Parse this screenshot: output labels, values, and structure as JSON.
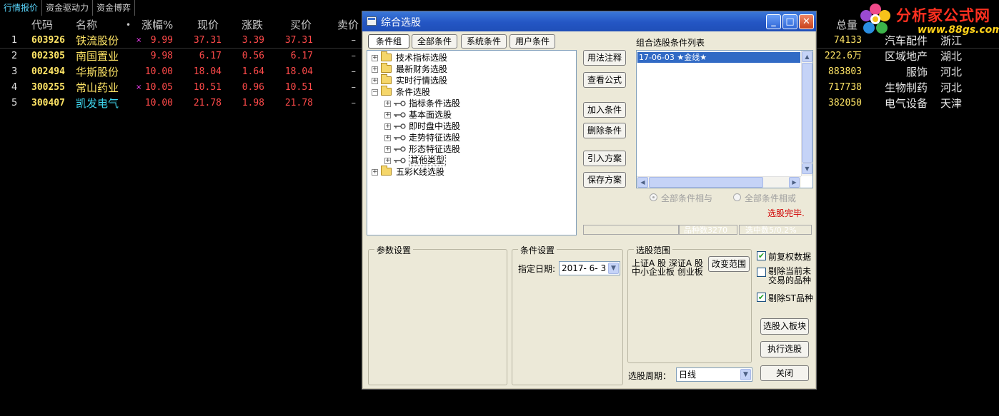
{
  "tabs": [
    "行情报价",
    "资金驱动力",
    "资金博弈"
  ],
  "table": {
    "headers": {
      "code": "代码",
      "name": "名称",
      "dot": "•",
      "pct": "涨幅%",
      "price": "现价",
      "change": "涨跌",
      "bid": "买价",
      "ask": "卖价",
      "volume": "总量"
    },
    "rows": [
      {
        "idx": "1",
        "code": "603926",
        "name": "铁流股份",
        "mark": "×",
        "pct": "9.99",
        "price": "37.31",
        "change": "3.39",
        "bid": "37.31",
        "ask": "–",
        "volume": "74133",
        "industry": "汽车配件",
        "region": "浙江"
      },
      {
        "idx": "2",
        "code": "002305",
        "name": "南国置业",
        "mark": "",
        "pct": "9.98",
        "price": "6.17",
        "change": "0.56",
        "bid": "6.17",
        "ask": "–",
        "volume": "222.6万",
        "industry": "区域地产",
        "region": "湖北"
      },
      {
        "idx": "3",
        "code": "002494",
        "name": "华斯股份",
        "mark": "",
        "pct": "10.00",
        "price": "18.04",
        "change": "1.64",
        "bid": "18.04",
        "ask": "–",
        "volume": "883803",
        "industry": "服饰",
        "region": "河北"
      },
      {
        "idx": "4",
        "code": "300255",
        "name": "常山药业",
        "mark": "×",
        "pct": "10.05",
        "price": "10.51",
        "change": "0.96",
        "bid": "10.51",
        "ask": "–",
        "volume": "717738",
        "industry": "生物制药",
        "region": "河北"
      },
      {
        "idx": "5",
        "code": "300407",
        "name": "凯发电气",
        "mark": "",
        "pct": "10.00",
        "price": "21.78",
        "change": "1.98",
        "bid": "21.78",
        "ask": "–",
        "volume": "382050",
        "industry": "电气设备",
        "region": "天津"
      }
    ]
  },
  "logo": {
    "text": "分析家公式网",
    "url": "www.88gs.com"
  },
  "dialog": {
    "title": "综合选股",
    "controls": {
      "minimize": "_",
      "maximize": "□",
      "close": "✕"
    },
    "tabs": [
      "条件组",
      "全部条件",
      "系统条件",
      "用户条件"
    ],
    "tree": {
      "top": [
        "技术指标选股",
        "最新财务选股",
        "实时行情选股",
        "条件选股"
      ],
      "sub": [
        "指标条件选股",
        "基本面选股",
        "即时盘中选股",
        "走势特征选股",
        "形态特征选股",
        "其他类型"
      ],
      "bottom": "五彩K线选股"
    },
    "buttons": {
      "usage": "用法注释",
      "view_formula": "查看公式",
      "add": "加入条件",
      "delete": "删除条件",
      "import": "引入方案",
      "save": "保存方案",
      "change_range": "改变范围",
      "to_block": "选股入板块",
      "execute": "执行选股",
      "close": "关闭"
    },
    "cond_list_title": "组合选股条件列表",
    "cond_list": [
      "17-06-03 ★金线★"
    ],
    "radio_and": "全部条件相与",
    "radio_or": "全部条件相或",
    "status": "选股完毕.",
    "status_color": "#d00000",
    "count_label": "品种数3270",
    "selected_label": "选中数5/0.2%",
    "param_group": "参数设置",
    "cond_group": "条件设置",
    "date_label": "指定日期:",
    "date_value": "2017- 6- 3",
    "range_group": "选股范围",
    "range_line1": "上证A 股  深证A 股",
    "range_line2": "中小企业板  创业板",
    "period_label": "选股周期：",
    "period_value": "日线",
    "checks": [
      {
        "label": "前复权数据",
        "checked": true
      },
      {
        "label": "剔除当前未交易的品种",
        "checked": false
      },
      {
        "label": "剔除ST品种",
        "checked": true
      }
    ],
    "check_line2_a": "剔除当前未",
    "check_line2_b": "交易的品种"
  }
}
